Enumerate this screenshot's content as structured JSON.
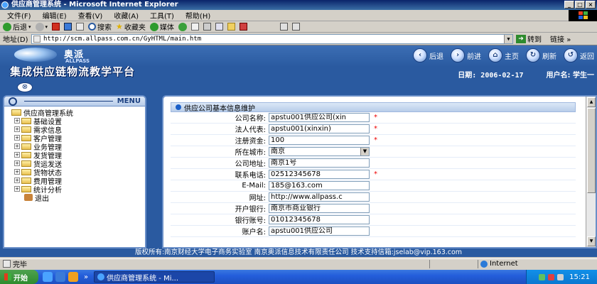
{
  "window": {
    "title": "供应商管理系统 - Microsoft Internet Explorer",
    "controls": [
      "_",
      "□",
      "×"
    ]
  },
  "menubar": {
    "items": [
      "文件(F)",
      "编辑(E)",
      "查看(V)",
      "收藏(A)",
      "工具(T)",
      "帮助(H)"
    ]
  },
  "toolbar": {
    "back": "后退",
    "search": "搜索",
    "favorites": "收藏夹",
    "media": "媒体"
  },
  "addressbar": {
    "label": "地址(D)",
    "url": "http://scm.allpass.com.cn/GyHTML/main.htm",
    "go": "转到",
    "links": "链接",
    "links_arrow": "»"
  },
  "app": {
    "brand": "奥派",
    "brand_en": "ALLPASS",
    "platform_title": "集成供应链物流教学平台",
    "nav": {
      "back": "后退",
      "forward": "前进",
      "home": "主页",
      "refresh": "刷新",
      "return": "返回"
    },
    "date_label": "日期: 2006-02-17",
    "user_label": "用户名: 学生一"
  },
  "menu": {
    "header": "MENU",
    "root": "供应商管理系统",
    "items": [
      "基础设置",
      "需求信息",
      "客户管理",
      "业务管理",
      "发货管理",
      "货运发送",
      "货物状态",
      "费用管理",
      "统计分析"
    ],
    "logout": "退出"
  },
  "form": {
    "title": "供应公司基本信息维护",
    "required_mark": "*",
    "fields": {
      "company_name": {
        "label": "公司名称:",
        "value": "apstu001供应公司(xin"
      },
      "legal_rep": {
        "label": "法人代表:",
        "value": "apstu001(xinxin)"
      },
      "capital": {
        "label": "注册资金:",
        "value": "100"
      },
      "city": {
        "label": "所在城市:",
        "value": "南京"
      },
      "address": {
        "label": "公司地址:",
        "value": "南京1号"
      },
      "phone": {
        "label": "联系电话:",
        "value": "02512345678"
      },
      "email": {
        "label": "E-Mail:",
        "value": "185@163.com"
      },
      "website": {
        "label": "网址:",
        "value": "http://www.allpass.c"
      },
      "bank": {
        "label": "开户银行:",
        "value": "南京市商业银行"
      },
      "account_no": {
        "label": "银行账号:",
        "value": "01012345678"
      },
      "account_name": {
        "label": "账户名:",
        "value": "apstu001供应公司"
      }
    }
  },
  "footer": {
    "text": "版权所有:南京财经大学电子商务实验室 南京奥派信息技术有限责任公司 技术支持信箱:jselab@vip.163.com"
  },
  "statusbar": {
    "status": "完毕",
    "zone": "Internet"
  },
  "taskbar": {
    "start": "开始",
    "task_item": "供应商管理系统 - Mi...",
    "clock": "15:21",
    "more": "»"
  },
  "colors": {
    "app_blue": "#2a5aa0",
    "panel_border": "#6a8fc8",
    "required": "#e00000"
  }
}
